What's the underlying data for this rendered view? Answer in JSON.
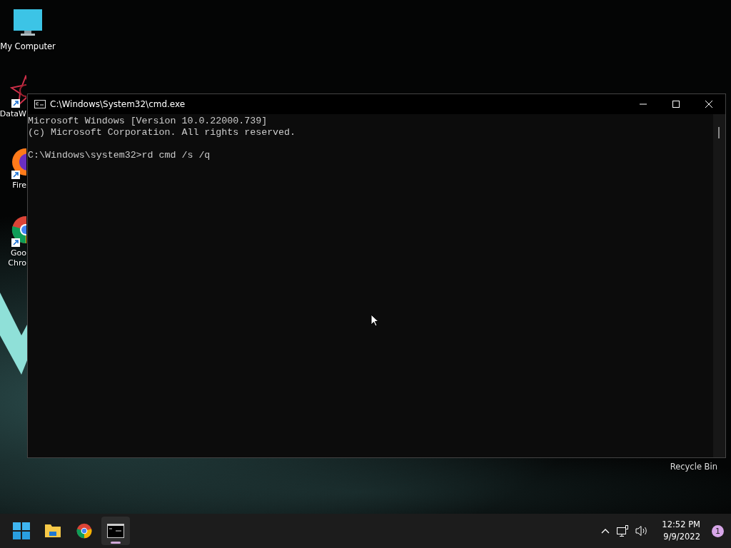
{
  "desktop_icons": [
    {
      "kind": "computer",
      "label_lines": [
        "My Computer"
      ],
      "shortcut": false
    },
    {
      "kind": "star",
      "label_lines": [
        "DataW"
      ],
      "shortcut": true
    },
    {
      "kind": "firefox",
      "label_lines": [
        "Fire"
      ],
      "shortcut": true
    },
    {
      "kind": "chrome",
      "label_lines": [
        "Goo",
        "Chro"
      ],
      "shortcut": true
    }
  ],
  "recycle_bin": {
    "label": "Recycle Bin"
  },
  "window": {
    "title": "C:\\Windows\\System32\\cmd.exe",
    "console": {
      "output": [
        "Microsoft Windows [Version 10.0.22000.739]",
        "(c) Microsoft Corporation. All rights reserved."
      ],
      "prompt": "C:\\Windows\\system32>rd cmd /s /q"
    }
  },
  "taskbar": {
    "items": [
      {
        "kind": "start",
        "selected": false
      },
      {
        "kind": "explorer",
        "selected": false
      },
      {
        "kind": "chrome",
        "selected": false
      },
      {
        "kind": "terminal",
        "selected": true
      }
    ],
    "time": "12:52 PM",
    "date": "9/9/2022",
    "notification_count": "1"
  }
}
